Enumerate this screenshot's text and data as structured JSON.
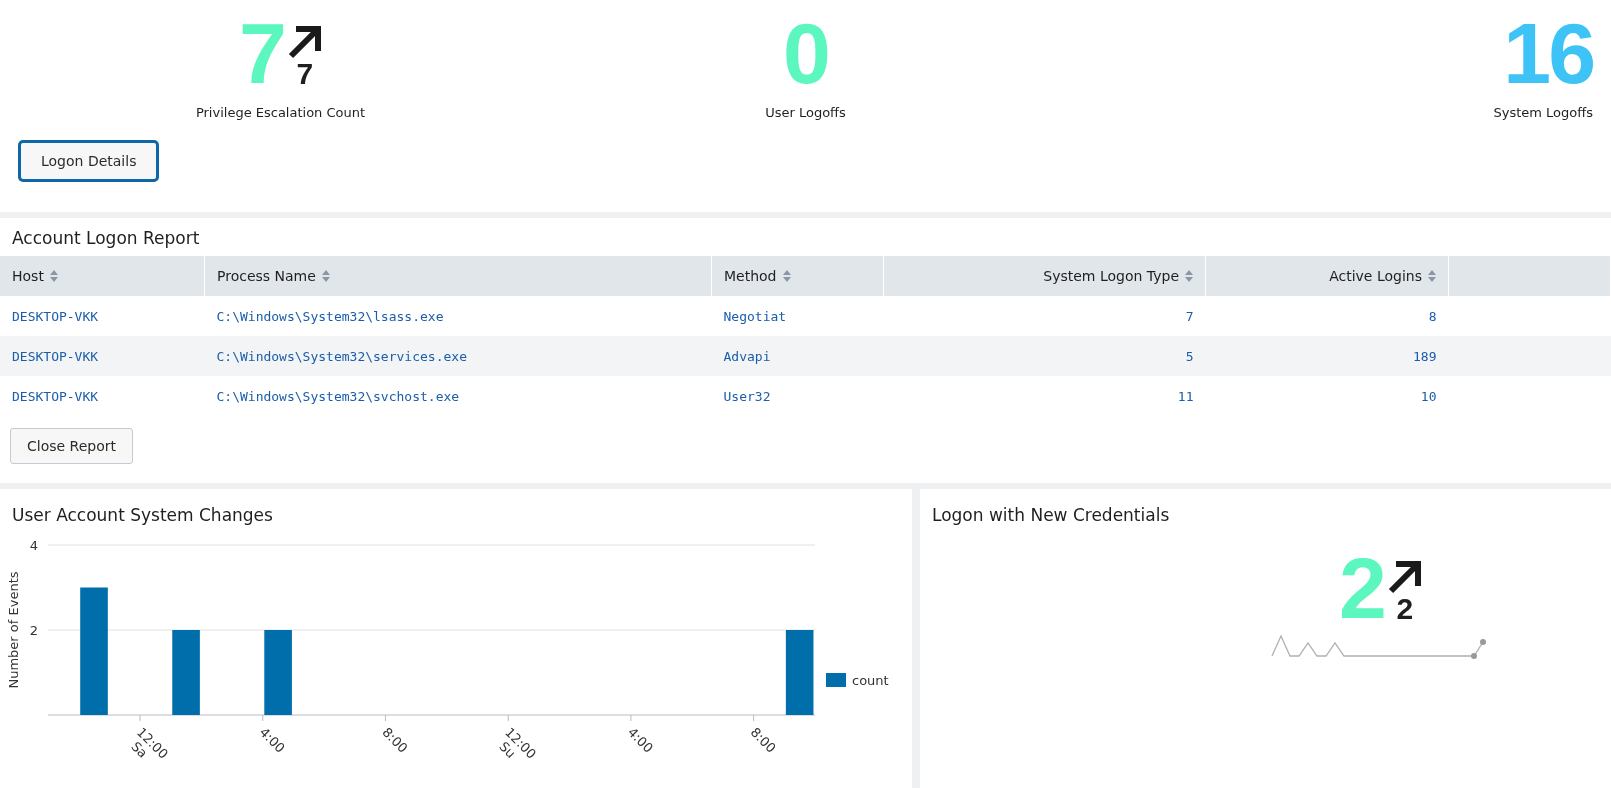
{
  "single_values": [
    {
      "value": "7",
      "color": "#5cf7be",
      "trend": {
        "delta": "7"
      },
      "label": "Privilege Escalation Count"
    },
    {
      "value": "0",
      "color": "#5cf7be",
      "label": "User Logoffs"
    },
    {
      "value": "16",
      "color": "#3ec3f7",
      "label": "System Logoffs"
    }
  ],
  "logon_details_button": {
    "label": "Logon Details",
    "focused": true
  },
  "report": {
    "title": "Account Logon Report",
    "columns": [
      "Host",
      "Process Name",
      "Method",
      "System Logon Type",
      "Active Logins"
    ],
    "rows": [
      [
        "DESKTOP-VKK",
        "C:\\Windows\\System32\\lsass.exe",
        "Negotiat",
        "7",
        "8"
      ],
      [
        "DESKTOP-VKK",
        "C:\\Windows\\System32\\services.exe",
        "Advapi",
        "5",
        "189"
      ],
      [
        "DESKTOP-VKK",
        "C:\\Windows\\System32\\svchost.exe",
        "User32",
        "11",
        "10"
      ]
    ],
    "close_button": "Close Report"
  },
  "changes_panel": {
    "title": "User Account System Changes",
    "chart_data": {
      "type": "bar",
      "ylabel": "Number of Events",
      "ylim": [
        0,
        4
      ],
      "yticks": [
        2,
        4
      ],
      "categories": [
        null,
        null,
        null,
        "12:00\nSa",
        null,
        null,
        null,
        "4:00",
        null,
        null,
        null,
        "8:00",
        null,
        null,
        null,
        "12:00\nSu",
        null,
        null,
        null,
        "4:00",
        null,
        null,
        null,
        "8:00",
        null
      ],
      "series": [
        {
          "name": "count",
          "color": "#006eaa",
          "values": [
            null,
            3,
            null,
            null,
            2,
            null,
            null,
            2,
            null,
            null,
            null,
            null,
            null,
            null,
            null,
            null,
            null,
            null,
            null,
            null,
            null,
            null,
            null,
            null,
            2
          ]
        }
      ]
    }
  },
  "credentials_panel": {
    "title": "Logon with New Credentials",
    "value": "2",
    "color": "#5cf7be",
    "trend": {
      "delta": "2"
    }
  }
}
